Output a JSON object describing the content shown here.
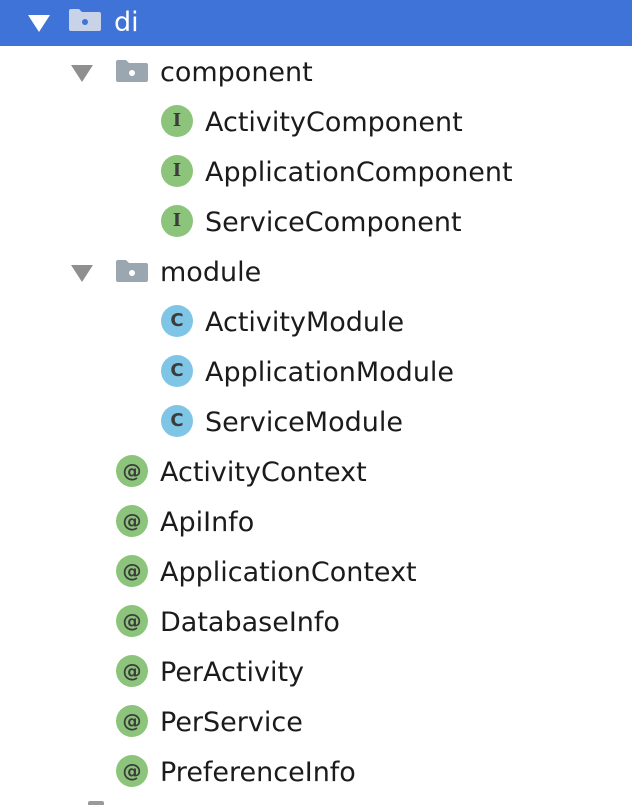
{
  "tree": {
    "root": {
      "label": "di",
      "expanded": true,
      "icon": "package-folder-icon"
    },
    "folders": [
      {
        "label": "component",
        "expanded": true,
        "icon": "package-folder-icon",
        "children": [
          {
            "label": "ActivityComponent",
            "kind": "interface",
            "badge": "I"
          },
          {
            "label": "ApplicationComponent",
            "kind": "interface",
            "badge": "I"
          },
          {
            "label": "ServiceComponent",
            "kind": "interface",
            "badge": "I"
          }
        ]
      },
      {
        "label": "module",
        "expanded": true,
        "icon": "package-folder-icon",
        "children": [
          {
            "label": "ActivityModule",
            "kind": "class",
            "badge": "C"
          },
          {
            "label": "ApplicationModule",
            "kind": "class",
            "badge": "C"
          },
          {
            "label": "ServiceModule",
            "kind": "class",
            "badge": "C"
          }
        ]
      }
    ],
    "annotations": [
      {
        "label": "ActivityContext",
        "badge": "@"
      },
      {
        "label": "ApiInfo",
        "badge": "@"
      },
      {
        "label": "ApplicationContext",
        "badge": "@"
      },
      {
        "label": "DatabaseInfo",
        "badge": "@"
      },
      {
        "label": "PerActivity",
        "badge": "@"
      },
      {
        "label": "PerService",
        "badge": "@"
      },
      {
        "label": "PreferenceInfo",
        "badge": "@"
      }
    ]
  },
  "colors": {
    "selection": "#3f73d8",
    "interface_badge": "#8cc47b",
    "class_badge": "#7fc6e6",
    "annotation_badge": "#8cc47b",
    "folder_icon": "#9aa7b0",
    "arrow": "#8f8f8f"
  }
}
